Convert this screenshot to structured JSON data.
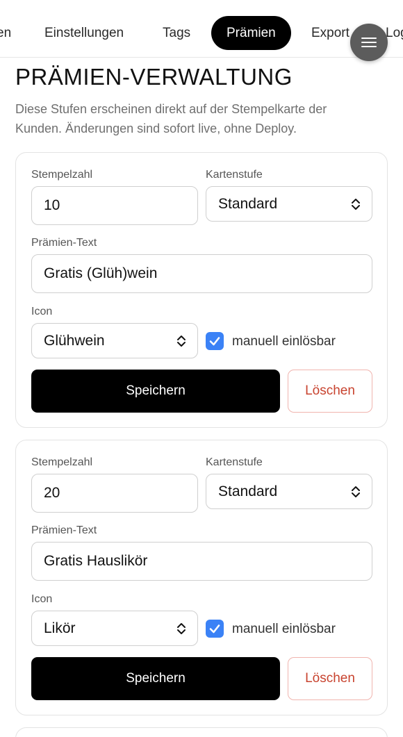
{
  "nav": {
    "tabs": [
      "en",
      "Einstellungen",
      "Tags",
      "Prämien",
      "Export",
      "Log"
    ],
    "active_tab": "Prämien"
  },
  "page": {
    "title": "PRÄMIEN-VERWALTUNG",
    "description": "Diese Stufen erscheinen direkt auf der Stempelkarte der Kunden. Änderungen sind sofort live, ohne Deploy."
  },
  "labels": {
    "stamps": "Stempelzahl",
    "tier": "Kartenstufe",
    "reward_text": "Prämien-Text",
    "icon": "Icon",
    "manual": "manuell einlösbar",
    "save": "Speichern",
    "delete": "Löschen"
  },
  "rewards": [
    {
      "stamps": "10",
      "tier": "Standard",
      "text": "Gratis (Glüh)wein",
      "icon": "Glühwein",
      "manual": true
    },
    {
      "stamps": "20",
      "tier": "Standard",
      "text": "Gratis Hauslikör",
      "icon": "Likör",
      "manual": true
    }
  ],
  "colors": {
    "accent": "#3b82f6",
    "danger": "#c8432f",
    "primary": "#000000"
  }
}
